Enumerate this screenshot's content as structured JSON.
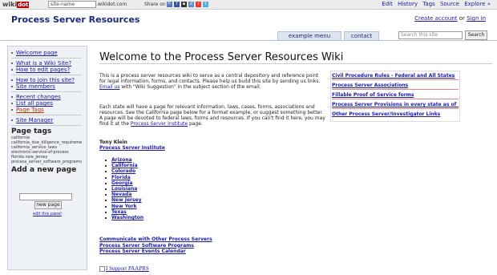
{
  "topbar": {
    "logo": "wiki",
    "logo_badge": "dot",
    "site_name_placeholder": "site-name",
    "domain_suffix": ".wikidot.com",
    "share_label": "Share on",
    "links": [
      "Edit",
      "History",
      "Tags",
      "Source",
      "Explore »"
    ]
  },
  "header": {
    "site_title": "Process Server Resources",
    "create_account": "Create account",
    "or": "or",
    "sign_in": "Sign in",
    "nav": [
      "example menu",
      "contact"
    ],
    "search_placeholder": "Search this site",
    "search_button": "Search"
  },
  "sidebar": {
    "menu": [
      {
        "label": "Welcome page"
      },
      {
        "label": "What is a Wiki Site?"
      },
      {
        "label": "How to edit pages?"
      },
      {
        "label": "How to join this site?"
      },
      {
        "label": "Site members"
      },
      {
        "label": "Recent changes"
      },
      {
        "label": "List all pages"
      },
      {
        "label": "Page Tags"
      },
      {
        "label": "Site Manager"
      }
    ],
    "tags_heading": "Page tags",
    "tags": [
      "california",
      "california_due_diligence_requirements",
      "california_service_laws",
      "electronic-service-of-process",
      "florida   new_jersey",
      "process_server_software_programs"
    ],
    "add_heading": "Add a new page",
    "new_page_button": "new page",
    "edit_panel": "edit this panel"
  },
  "main": {
    "title": "Welcome to the Process Server Resources Wiki",
    "para1": "This is a process server resources wiki to serve as a central depository and reference point for legal information, forms, and contacts. Please help us build this site by sending us links.",
    "para1_email": "Email us",
    "para1_tail": " with \"Wiki Suggestion\" in the subject section of the email.",
    "para2": "Each state will have a page for relevant information, laws, cases, forms, associations and resources. See the California page below for a format example, or suggest something better. A page will be devoted to federal laws, forms and resources. If you can't find it here, you may find it at the ",
    "para2_link": "Process Server Institute",
    "para2_tail": " page.",
    "author_name": "Tony Klein",
    "author_link": "Process Server Institute",
    "states": [
      "Arizona",
      "California",
      "Colorado",
      "Florida",
      "Georgia",
      "Louisiana",
      "Nevada",
      "New Jersey",
      "New York",
      "Texas",
      "Washington"
    ],
    "extra_links": [
      "Communicate with Other Process Servers",
      "Process Server Software Programs",
      "Process Server Events Calendar"
    ],
    "support_image_alt": "I Support PAAPRS"
  },
  "right_links": [
    "Civil Procedure Rules - Federal and All States",
    "Process Server Associations",
    "Fillable Proof of Service forms",
    "Process Server Provisions in every state as of 2009",
    "Other Process Server/Investigator Links"
  ],
  "colors": {
    "accent": "#1a1aa6",
    "title": "#1a2a7a",
    "sidebar_bg": "#eef1f6",
    "logo_badge": "#bb0000"
  }
}
